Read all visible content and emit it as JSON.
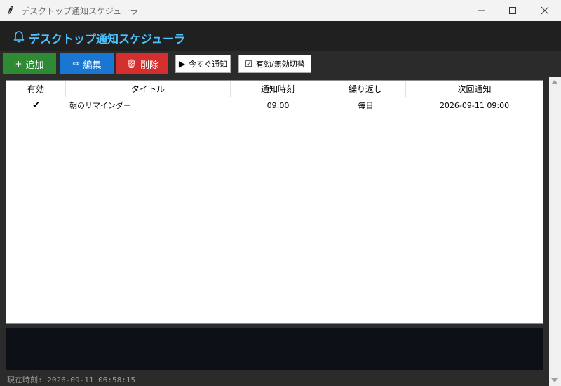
{
  "window": {
    "title": "デスクトップ通知スケジューラ"
  },
  "header": {
    "title": "デスクトップ通知スケジューラ",
    "icon": "bell-icon"
  },
  "toolbar": {
    "add": {
      "icon": "+",
      "label": "追加"
    },
    "edit": {
      "icon": "✏",
      "label": "編集"
    },
    "delete": {
      "icon": "🗑",
      "label": "削除"
    },
    "notify_now": {
      "icon": "▶",
      "label": "今すぐ通知"
    },
    "toggle": {
      "icon": "☑",
      "label": "有効/無効切替"
    }
  },
  "table": {
    "columns": [
      "有効",
      "タイトル",
      "通知時刻",
      "繰り返し",
      "次回通知"
    ],
    "rows": [
      {
        "enabled": "✔",
        "title": "朝のリマインダー",
        "time": "09:00",
        "repeat": "毎日",
        "next": "2026-09-11 09:00"
      }
    ]
  },
  "status": {
    "text": "現在時刻: 2026-09-11 06:58:15"
  },
  "colors": {
    "accent": "#4cc3ff",
    "add": "#2e8b34",
    "edit": "#1976d2",
    "delete": "#d32f2f",
    "log_bg": "#0d1117"
  }
}
